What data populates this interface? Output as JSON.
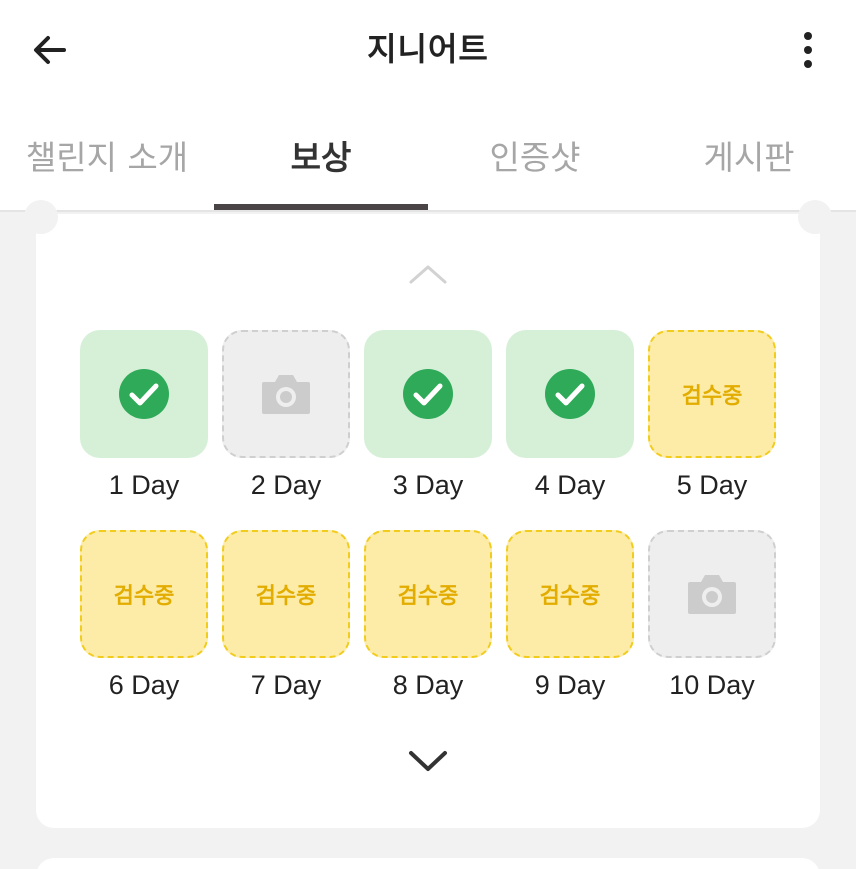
{
  "header": {
    "title": "지니어트",
    "back_icon": "arrow-left-icon",
    "more_icon": "more-vertical-icon"
  },
  "tabs": [
    {
      "label": "챌린지 소개",
      "active": false
    },
    {
      "label": "보상",
      "active": true
    },
    {
      "label": "인증샷",
      "active": false
    },
    {
      "label": "게시판",
      "active": false
    }
  ],
  "colors": {
    "done_bg": "#d6f0d8",
    "check_green": "#2eaa58",
    "review_bg": "#fdeca8",
    "review_text": "#e2ad00",
    "empty_bg": "#eeeeee",
    "tab_indicator": "#4a4446"
  },
  "days": [
    {
      "label": "1 Day",
      "status": "done"
    },
    {
      "label": "2 Day",
      "status": "empty"
    },
    {
      "label": "3 Day",
      "status": "done"
    },
    {
      "label": "4 Day",
      "status": "done"
    },
    {
      "label": "5 Day",
      "status": "review",
      "text": "검수중"
    },
    {
      "label": "6 Day",
      "status": "review",
      "text": "검수중"
    },
    {
      "label": "7 Day",
      "status": "review",
      "text": "검수중"
    },
    {
      "label": "8 Day",
      "status": "review",
      "text": "검수중"
    },
    {
      "label": "9 Day",
      "status": "review",
      "text": "검수중"
    },
    {
      "label": "10 Day",
      "status": "empty"
    }
  ]
}
